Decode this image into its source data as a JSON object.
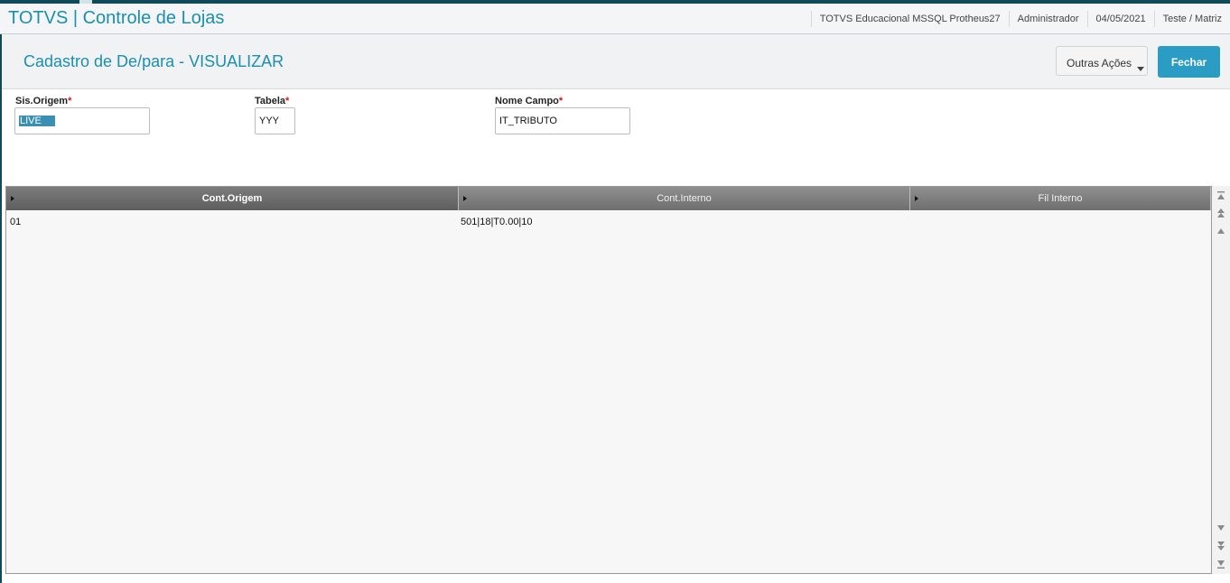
{
  "app": {
    "title": "TOTVS | Controle de Lojas"
  },
  "header_info": {
    "environment": "TOTVS Educacional MSSQL Protheus27",
    "user": "Administrador",
    "date": "04/05/2021",
    "company": "Teste / Matriz"
  },
  "page": {
    "title": "Cadastro de De/para - VISUALIZAR"
  },
  "buttons": {
    "outras_acoes": "Outras Ações",
    "fechar": "Fechar"
  },
  "form": {
    "required_mark": "*",
    "sis_origem": {
      "label": "Sis.Origem",
      "value": "LIVE"
    },
    "tabela": {
      "label": "Tabela",
      "value": "YYY"
    },
    "nome_campo": {
      "label": "Nome Campo",
      "value": "IT_TRIBUTO"
    }
  },
  "grid": {
    "columns": [
      "Cont.Origem",
      "Cont.Interno",
      "Fil Interno"
    ],
    "rows": [
      {
        "cont_origem": "01",
        "cont_interno": "501|18|T0.00|10",
        "fil_interno": ""
      }
    ]
  },
  "icons": {
    "scroll_top": "scroll-top-icon",
    "scroll_page_up": "scroll-page-up-icon",
    "scroll_up": "scroll-up-icon",
    "scroll_down": "scroll-down-icon",
    "scroll_page_down": "scroll-page-down-icon",
    "scroll_bottom": "scroll-bottom-icon",
    "dropdown": "chevron-down-icon",
    "column_marker": "triangle-right-icon"
  },
  "colors": {
    "accent": "#1a8fb0",
    "primary_button": "#2b9cc4",
    "top_bar": "#0e4a5a",
    "grid_header": "#7f7f7f"
  }
}
